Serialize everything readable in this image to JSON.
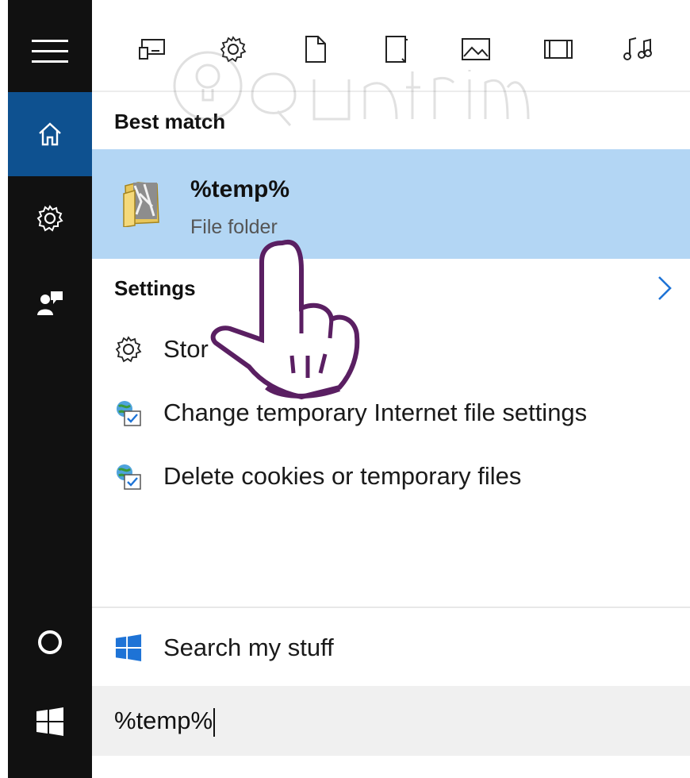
{
  "filters": [
    {
      "name": "apps-filter-icon"
    },
    {
      "name": "settings-filter-icon"
    },
    {
      "name": "documents-filter-icon"
    },
    {
      "name": "folders-filter-icon"
    },
    {
      "name": "photos-filter-icon"
    },
    {
      "name": "videos-filter-icon"
    },
    {
      "name": "music-filter-icon"
    }
  ],
  "sections": {
    "best_match": "Best match",
    "settings": "Settings"
  },
  "best": {
    "title": "%temp%",
    "subtitle": "File folder"
  },
  "settings_items": [
    {
      "label": "Stor",
      "icon": "gear-icon"
    },
    {
      "label": "Change temporary Internet file settings",
      "icon": "internet-options-icon"
    },
    {
      "label": "Delete cookies or temporary files",
      "icon": "internet-options-icon"
    }
  ],
  "search_my_stuff": "Search my stuff",
  "search": {
    "value": "%temp%"
  },
  "colors": {
    "rail": "#111111",
    "active": "#0e5190",
    "highlight": "#b3d6f4",
    "hand": "#5a1f62"
  }
}
